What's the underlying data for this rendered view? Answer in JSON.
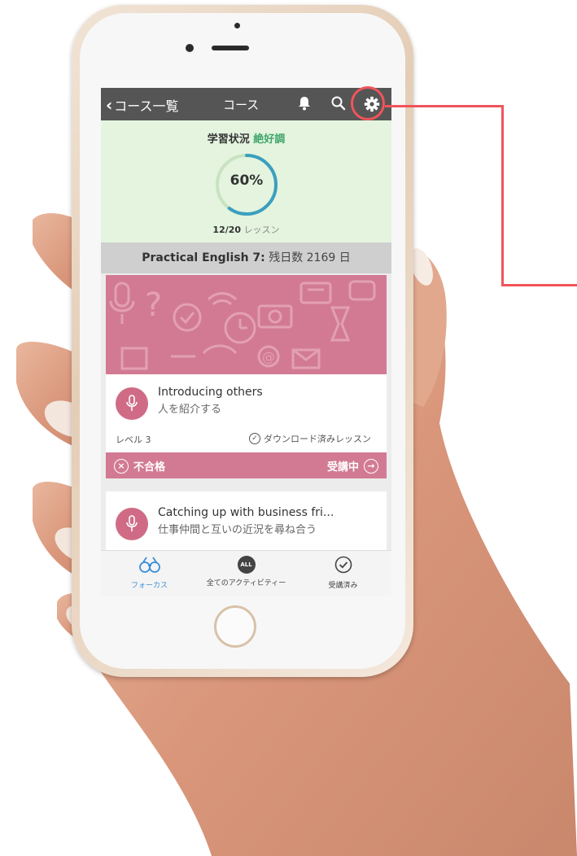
{
  "nav": {
    "back_label": "コース一覧",
    "title": "コース",
    "icons": [
      "bell-icon",
      "search-icon",
      "gear-icon"
    ]
  },
  "status": {
    "label": "学習状況",
    "rating": "絶好調",
    "progress_text": "60%",
    "progress": 0.6,
    "lessons_done": "12/20",
    "lessons_unit": "レッスン"
  },
  "course": {
    "name": "Practical English 7:",
    "remaining": "残日数 2169 日"
  },
  "lessons": [
    {
      "title": "Introducing others",
      "subtitle": "人を紹介する",
      "level": "レベル 3",
      "download": "ダウンロード済みレッスン",
      "result": "不合格",
      "state": "受講中"
    },
    {
      "title": "Catching up with business fri...",
      "subtitle": "仕事仲間と互いの近況を尋ね合う"
    }
  ],
  "tabs": [
    {
      "label": "フォーカス",
      "icon": "binoculars-icon"
    },
    {
      "label": "全てのアクティビティー",
      "icon": "all-icon",
      "badge": "ALL"
    },
    {
      "label": "受講済み",
      "icon": "check-circle-icon"
    }
  ],
  "colors": {
    "nav": "#555555",
    "status_bg": "#e4f4df",
    "accent_pink": "#d27a94",
    "ring": "#3b9fbf",
    "rating_green": "#3fa56b",
    "callout": "#f0545a",
    "tab_active": "#3a8fd9"
  }
}
